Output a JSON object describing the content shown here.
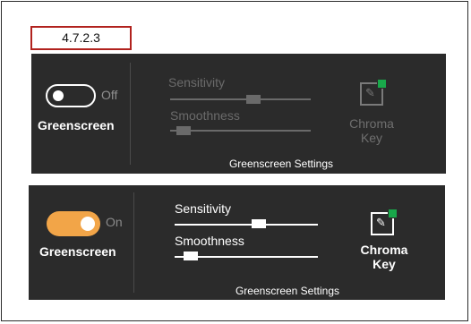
{
  "step_label": "4.7.2.3",
  "panel_off": {
    "toggle_state": "Off",
    "greenscreen_label": "Greenscreen",
    "sensitivity_label": "Sensitivity",
    "smoothness_label": "Smoothness",
    "sensitivity_value": 0.6,
    "smoothness_value": 0.05,
    "chroma_label_line1": "Chroma",
    "chroma_label_line2": "Key",
    "settings_title": "Greenscreen Settings"
  },
  "panel_on": {
    "toggle_state": "On",
    "greenscreen_label": "Greenscreen",
    "sensitivity_label": "Sensitivity",
    "smoothness_label": "Smoothness",
    "sensitivity_value": 0.6,
    "smoothness_value": 0.07,
    "chroma_label_line1": "Chroma",
    "chroma_label_line2": "Key",
    "settings_title": "Greenscreen Settings"
  },
  "colors": {
    "panel_bg": "#2b2b2b",
    "toggle_on": "#f2a548",
    "chroma_dot": "#19a84a",
    "label_border": "#b1221e"
  },
  "icons": {
    "chroma": "eyedropper-icon"
  }
}
